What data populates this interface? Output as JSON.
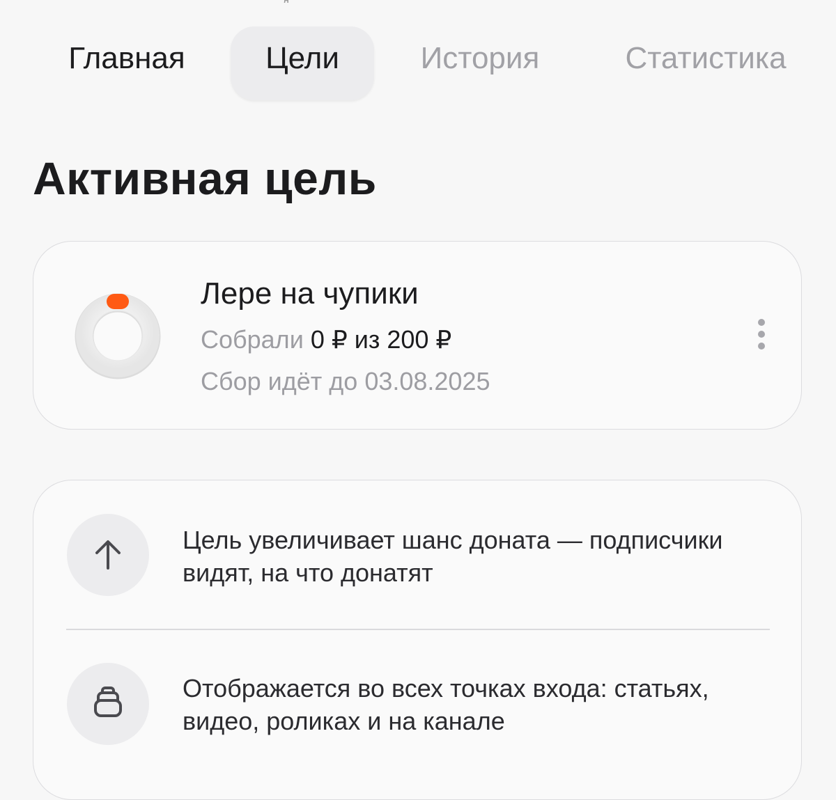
{
  "tabs": {
    "main": "Главная",
    "goals": "Цели",
    "history": "История",
    "stats": "Статистика",
    "active": "goals"
  },
  "section_title": "Активная цель",
  "goal": {
    "title": "Лере на чупики",
    "progress_label": "Собрали",
    "progress_value": "0 ₽ из 200 ₽",
    "collected": 0,
    "target": 200,
    "currency": "₽",
    "deadline": "Сбор идёт до 03.08.2025",
    "accent_color": "#ff5a14",
    "more_icon": "more-vertical-icon"
  },
  "info": {
    "items": [
      {
        "icon": "arrow-up-icon",
        "text": "Цель увеличивает шанс доната — подписчики видят, на что донатят"
      },
      {
        "icon": "stack-icon",
        "text": "Отображается во всех точках входа: статьях, видео, роликах и на канале"
      }
    ]
  },
  "colors": {
    "background": "#f7f7f7",
    "card_border": "#dcdcdf",
    "active_tab_bg": "#ececee",
    "inactive_tab_text": "#a1a1a6",
    "accent": "#ff5a14"
  }
}
